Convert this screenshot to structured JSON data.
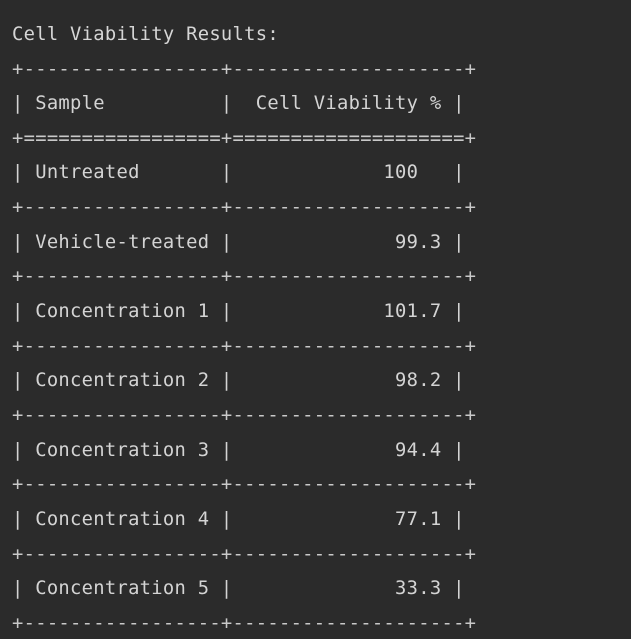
{
  "console": {
    "title": "Cell Viability Results:",
    "rules": {
      "thin": "+-----------------+--------------------+",
      "thick": "+=================+====================+"
    },
    "header_row": "| Sample          |  Cell Viability % |",
    "table": {
      "columns": [
        "Sample",
        "Cell Viability %"
      ],
      "rows_text": [
        "| Untreated       |             100   |",
        "| Vehicle-treated |              99.3 |",
        "| Concentration 1 |             101.7 |",
        "| Concentration 2 |              98.2 |",
        "| Concentration 3 |              94.4 |",
        "| Concentration 4 |              77.1 |",
        "| Concentration 5 |              33.3 |"
      ],
      "rows": [
        {
          "sample": "Untreated",
          "viability": "100"
        },
        {
          "sample": "Vehicle-treated",
          "viability": "99.3"
        },
        {
          "sample": "Concentration 1",
          "viability": "101.7"
        },
        {
          "sample": "Concentration 2",
          "viability": "98.2"
        },
        {
          "sample": "Concentration 3",
          "viability": "94.4"
        },
        {
          "sample": "Concentration 4",
          "viability": "77.1"
        },
        {
          "sample": "Concentration 5",
          "viability": "33.3"
        }
      ]
    }
  }
}
